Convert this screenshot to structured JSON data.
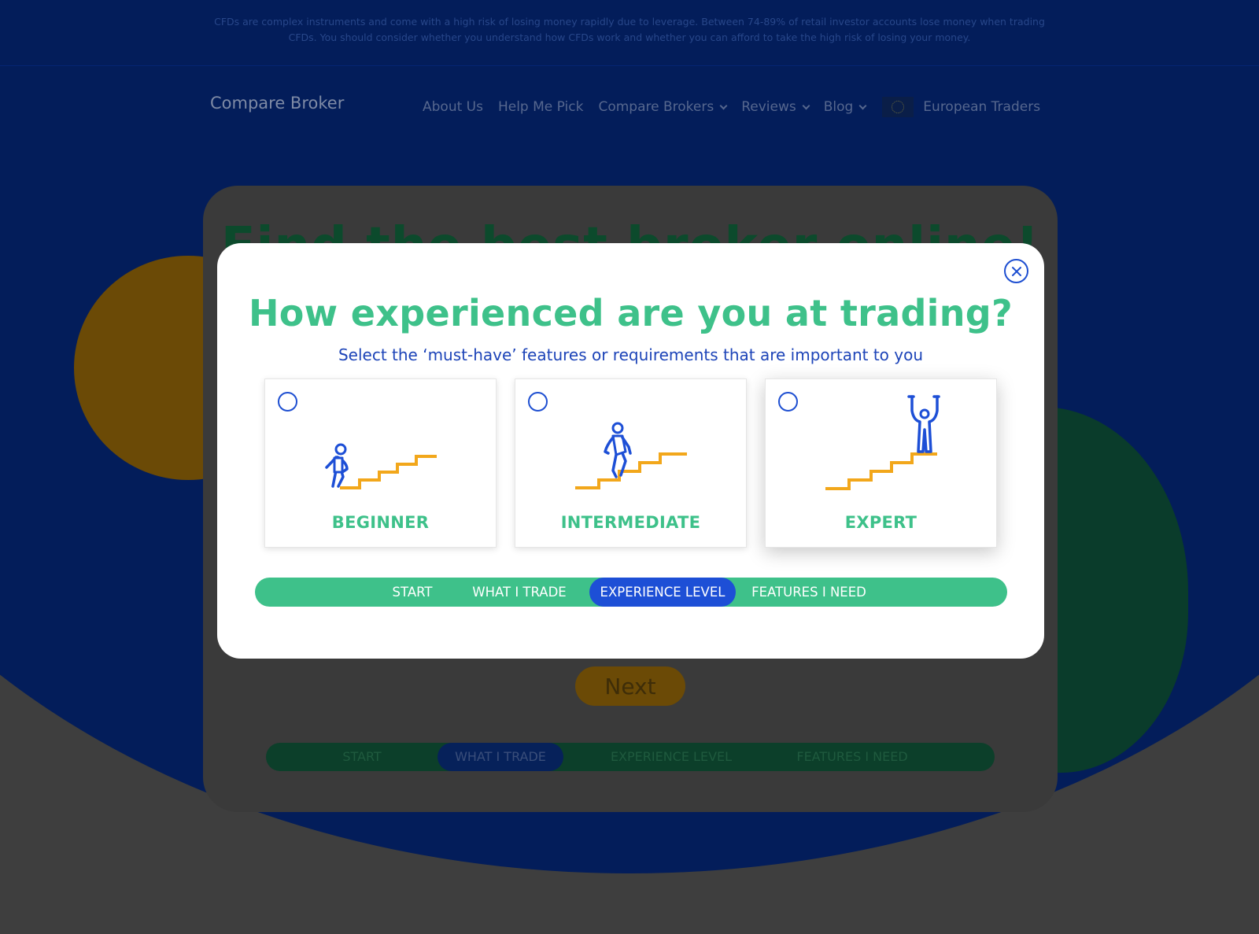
{
  "disclaimer": "CFDs are complex instruments and come with a high risk of losing money rapidly due to leverage. Between 74-89% of retail investor accounts lose money when trading CFDs. You should consider whether you understand how CFDs work and whether you can afford to take the high risk of losing your money.",
  "brand": "Compare Broker",
  "nav": {
    "about": "About Us",
    "help": "Help Me Pick",
    "compare": "Compare Brokers",
    "reviews": "Reviews",
    "blog": "Blog",
    "region": "European Traders"
  },
  "background": {
    "title": "Find the best broker online!",
    "next_label": "Next",
    "steps": [
      "START",
      "WHAT I TRADE",
      "EXPERIENCE LEVEL",
      "FEATURES I NEED"
    ],
    "active_step": "WHAT I TRADE"
  },
  "modal": {
    "title": "How experienced are you at trading?",
    "subtitle": "Select the ‘must-have’ features or requirements that are important to you",
    "options": [
      {
        "label": "BEGINNER",
        "icon": "beginner-stairs-icon"
      },
      {
        "label": "INTERMEDIATE",
        "icon": "intermediate-stairs-icon"
      },
      {
        "label": "EXPERT",
        "icon": "expert-stairs-icon"
      }
    ],
    "steps": [
      "START",
      "WHAT I TRADE",
      "EXPERIENCE LEVEL",
      "FEATURES I NEED"
    ],
    "active_step": "EXPERIENCE LEVEL"
  },
  "colors": {
    "accent_green": "#3ec18a",
    "accent_blue": "#1d4fd6",
    "stairs_orange": "#f2a71b",
    "page_blue": "#031d5a"
  }
}
